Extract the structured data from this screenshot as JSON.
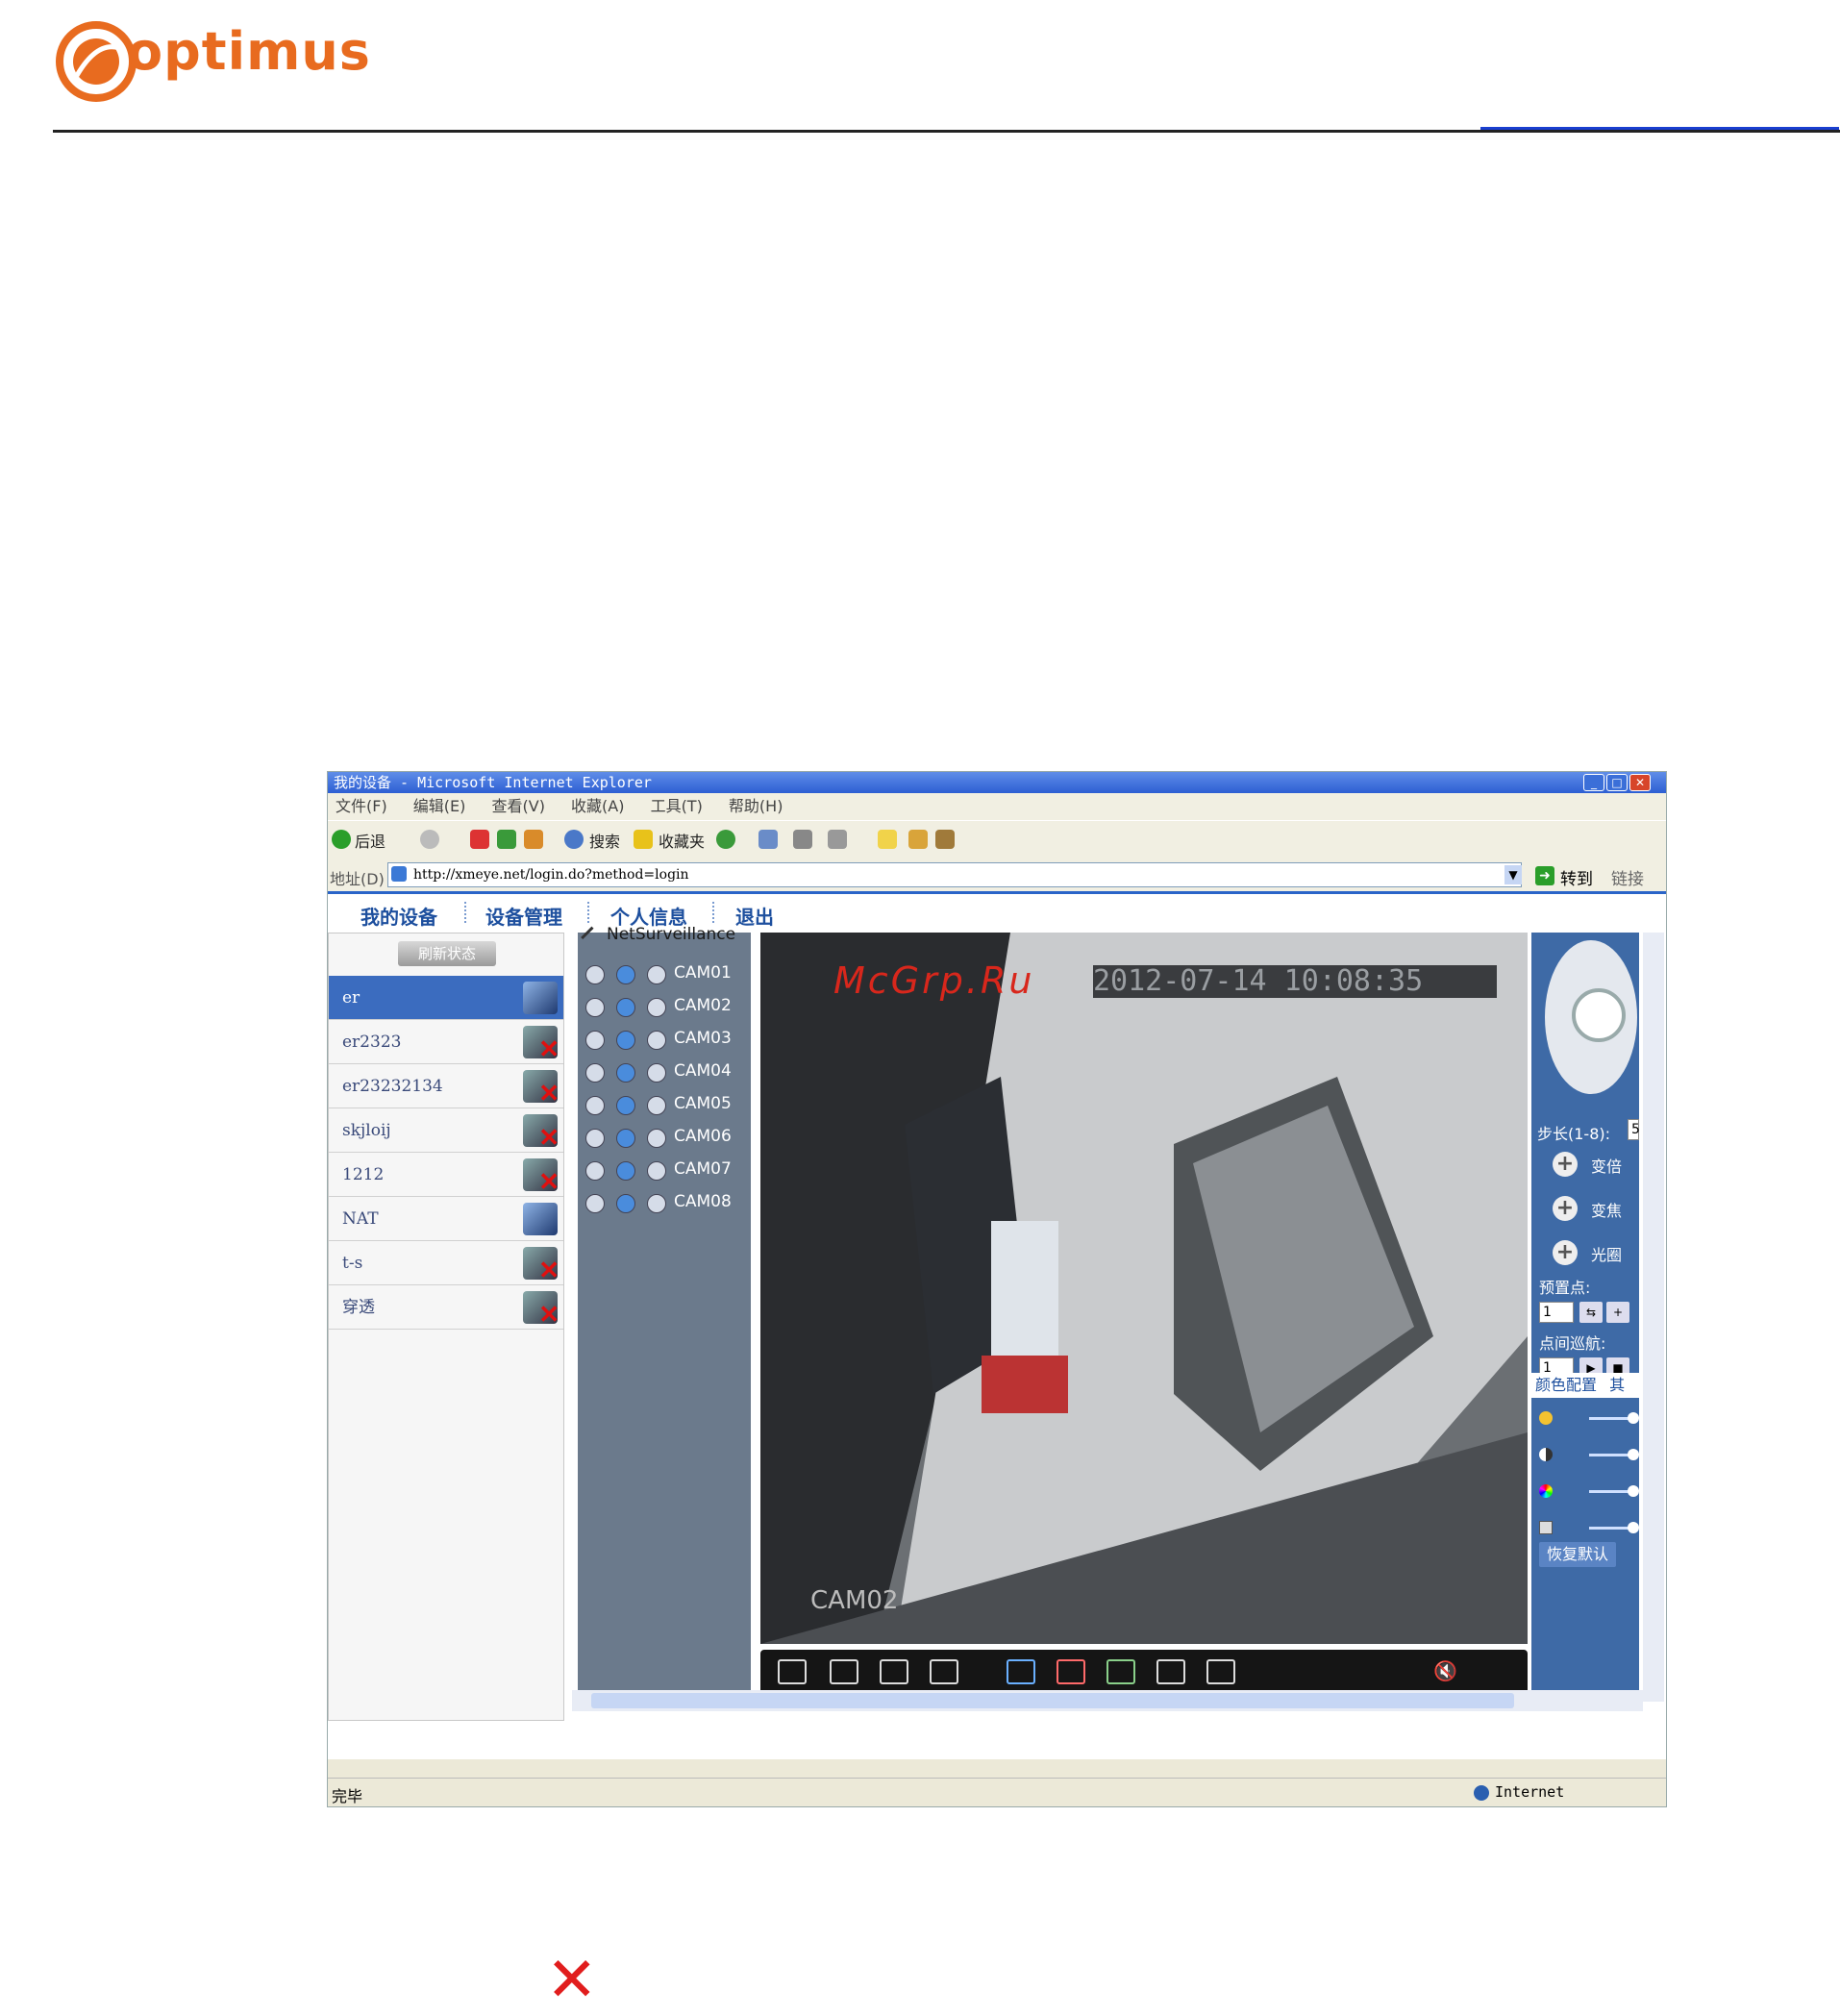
{
  "header": {
    "brand": "optimus"
  },
  "watermark": "McGrp.Ru",
  "browser": {
    "title": "我的设备 - Microsoft Internet Explorer",
    "menu": [
      "文件(F)",
      "编辑(E)",
      "查看(V)",
      "收藏(A)",
      "工具(T)",
      "帮助(H)"
    ],
    "toolbar": {
      "back": "后退",
      "search": "搜索",
      "favorites": "收藏夹"
    },
    "address_label": "地址(D)",
    "address": "http://xmeye.net/login.do?method=login",
    "go": "转到",
    "links": "链接",
    "status": "完毕",
    "zone": "Internet"
  },
  "app": {
    "nav": [
      "我的设备",
      "设备管理",
      "个人信息",
      "退出"
    ],
    "refresh": "刷新状态",
    "devices": [
      {
        "name": "er",
        "status": "online",
        "selected": true
      },
      {
        "name": "er2323",
        "status": "offline"
      },
      {
        "name": "er23232134",
        "status": "offline"
      },
      {
        "name": "skjloij",
        "status": "offline"
      },
      {
        "name": "1212",
        "status": "offline"
      },
      {
        "name": "NAT",
        "status": "online"
      },
      {
        "name": "t-s",
        "status": "offline"
      },
      {
        "name": "穿透",
        "status": "offline"
      }
    ],
    "net_label": "NetSurveillance",
    "cameras": [
      "CAM01",
      "CAM02",
      "CAM03",
      "CAM04",
      "CAM05",
      "CAM06",
      "CAM07",
      "CAM08"
    ],
    "video": {
      "timestamp": "2012-07-14 10:08:35",
      "camera": "CAM02"
    },
    "ptz": {
      "step_label": "步长(1-8):",
      "step_value": "5",
      "zoom": "变倍",
      "focus": "变焦",
      "iris": "光圈",
      "preset_label": "预置点:",
      "preset_value": "1",
      "tour_label": "点间巡航:",
      "tour_value": "1"
    },
    "color_tab": "颜色配置",
    "other_tab": "其",
    "restore": "恢复默认"
  },
  "colors": {
    "brand": "#e86b1f",
    "accent": "#2a64c8",
    "close": "#e11d1d"
  }
}
